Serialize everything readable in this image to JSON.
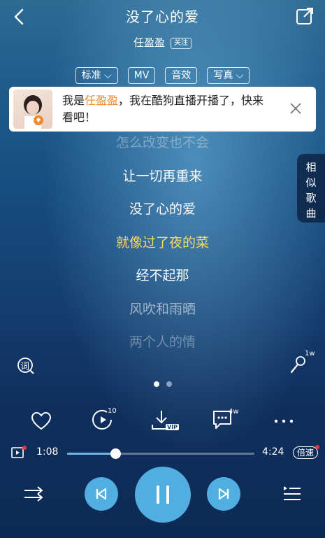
{
  "header": {
    "song_title": "没了心的爱",
    "artist": "任盈盈",
    "follow_label": "关注"
  },
  "chips": [
    {
      "label": "标准",
      "has_dropdown": true
    },
    {
      "label": "MV",
      "has_dropdown": false
    },
    {
      "label": "音效",
      "has_dropdown": false
    },
    {
      "label": "写真",
      "has_dropdown": true
    }
  ],
  "banner": {
    "prefix": "我是",
    "highlight": "任盈盈",
    "suffix": "，我在酷狗直播开播了，快来看吧！",
    "highlight_color": "#f08a2a"
  },
  "side_tab": {
    "label": "相似歌曲"
  },
  "lyrics": {
    "lines": [
      {
        "text": "怎么改变也不会",
        "state": "dimmer"
      },
      {
        "text": "让一切再重来",
        "state": "normal"
      },
      {
        "text": "没了心的爱",
        "state": "normal"
      },
      {
        "text": "就像过了夜的菜",
        "state": "current"
      },
      {
        "text": "经不起那",
        "state": "normal"
      },
      {
        "text": "风吹和雨晒",
        "state": "dim"
      },
      {
        "text": "两个人的情",
        "state": "dimmer"
      }
    ],
    "current_color": "#f7d86a"
  },
  "lyric_tools": {
    "lyric_icon_glyph": "词",
    "mic_count": "1w"
  },
  "pager": {
    "pages": 2,
    "active": 1
  },
  "actions": {
    "loop_count": "10",
    "download_badge": "VIP",
    "comment_count": "4w"
  },
  "progress": {
    "current_time": "1:08",
    "total_time": "4:24",
    "fraction": 0.2576,
    "speed_label": "倍速"
  },
  "colors": {
    "accent": "#52aee0",
    "progress_fill": "#6fb6e8"
  }
}
